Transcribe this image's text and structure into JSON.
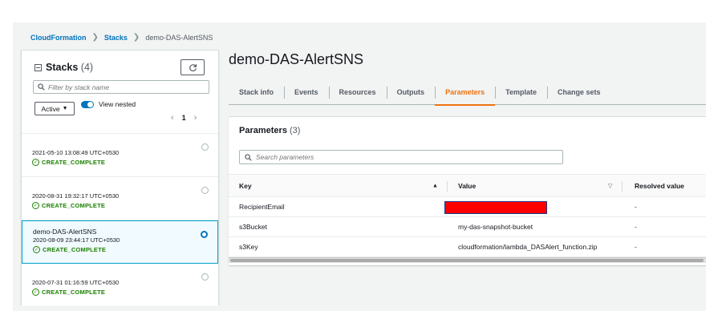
{
  "breadcrumb": {
    "items": [
      "CloudFormation",
      "Stacks"
    ],
    "current": "demo-DAS-AlertSNS"
  },
  "sidebar": {
    "title": "Stacks",
    "count": "(4)",
    "filter_placeholder": "Filter by stack name",
    "active_select": "Active",
    "view_nested_label": "View nested",
    "page": "1",
    "stacks": [
      {
        "name": "",
        "date": "2021-05-10 13:08:49 UTC+0530",
        "status": "CREATE_COMPLETE",
        "selected": false
      },
      {
        "name": "",
        "date": "2020-08-31 19:32:17 UTC+0530",
        "status": "CREATE_COMPLETE",
        "selected": false
      },
      {
        "name": "demo-DAS-AlertSNS",
        "date": "2020-08-09 23:44:17 UTC+0530",
        "status": "CREATE_COMPLETE",
        "selected": true
      },
      {
        "name": "",
        "date": "2020-07-31 01:16:59 UTC+0530",
        "status": "CREATE_COMPLETE",
        "selected": false
      }
    ]
  },
  "main": {
    "title": "demo-DAS-AlertSNS",
    "tabs": [
      {
        "label": "Stack info",
        "active": false
      },
      {
        "label": "Events",
        "active": false
      },
      {
        "label": "Resources",
        "active": false
      },
      {
        "label": "Outputs",
        "active": false
      },
      {
        "label": "Parameters",
        "active": true
      },
      {
        "label": "Template",
        "active": false
      },
      {
        "label": "Change sets",
        "active": false
      }
    ],
    "parameters": {
      "title": "Parameters",
      "count": "(3)",
      "search_placeholder": "Search parameters",
      "columns": [
        "Key",
        "Value",
        "Resolved value"
      ],
      "rows": [
        {
          "key": "RecipientEmail",
          "value": "",
          "resolved": "-",
          "redacted": true
        },
        {
          "key": "s3Bucket",
          "value": "my-das-snapshot-bucket",
          "resolved": "-",
          "redacted": false
        },
        {
          "key": "s3Key",
          "value": "cloudformation/lambda_DASAlert_function.zip",
          "resolved": "-",
          "redacted": false
        }
      ]
    }
  },
  "colors": {
    "link": "#0073bb",
    "active_tab": "#ec7211",
    "success": "#1d8102",
    "redaction": "#ff0000"
  }
}
